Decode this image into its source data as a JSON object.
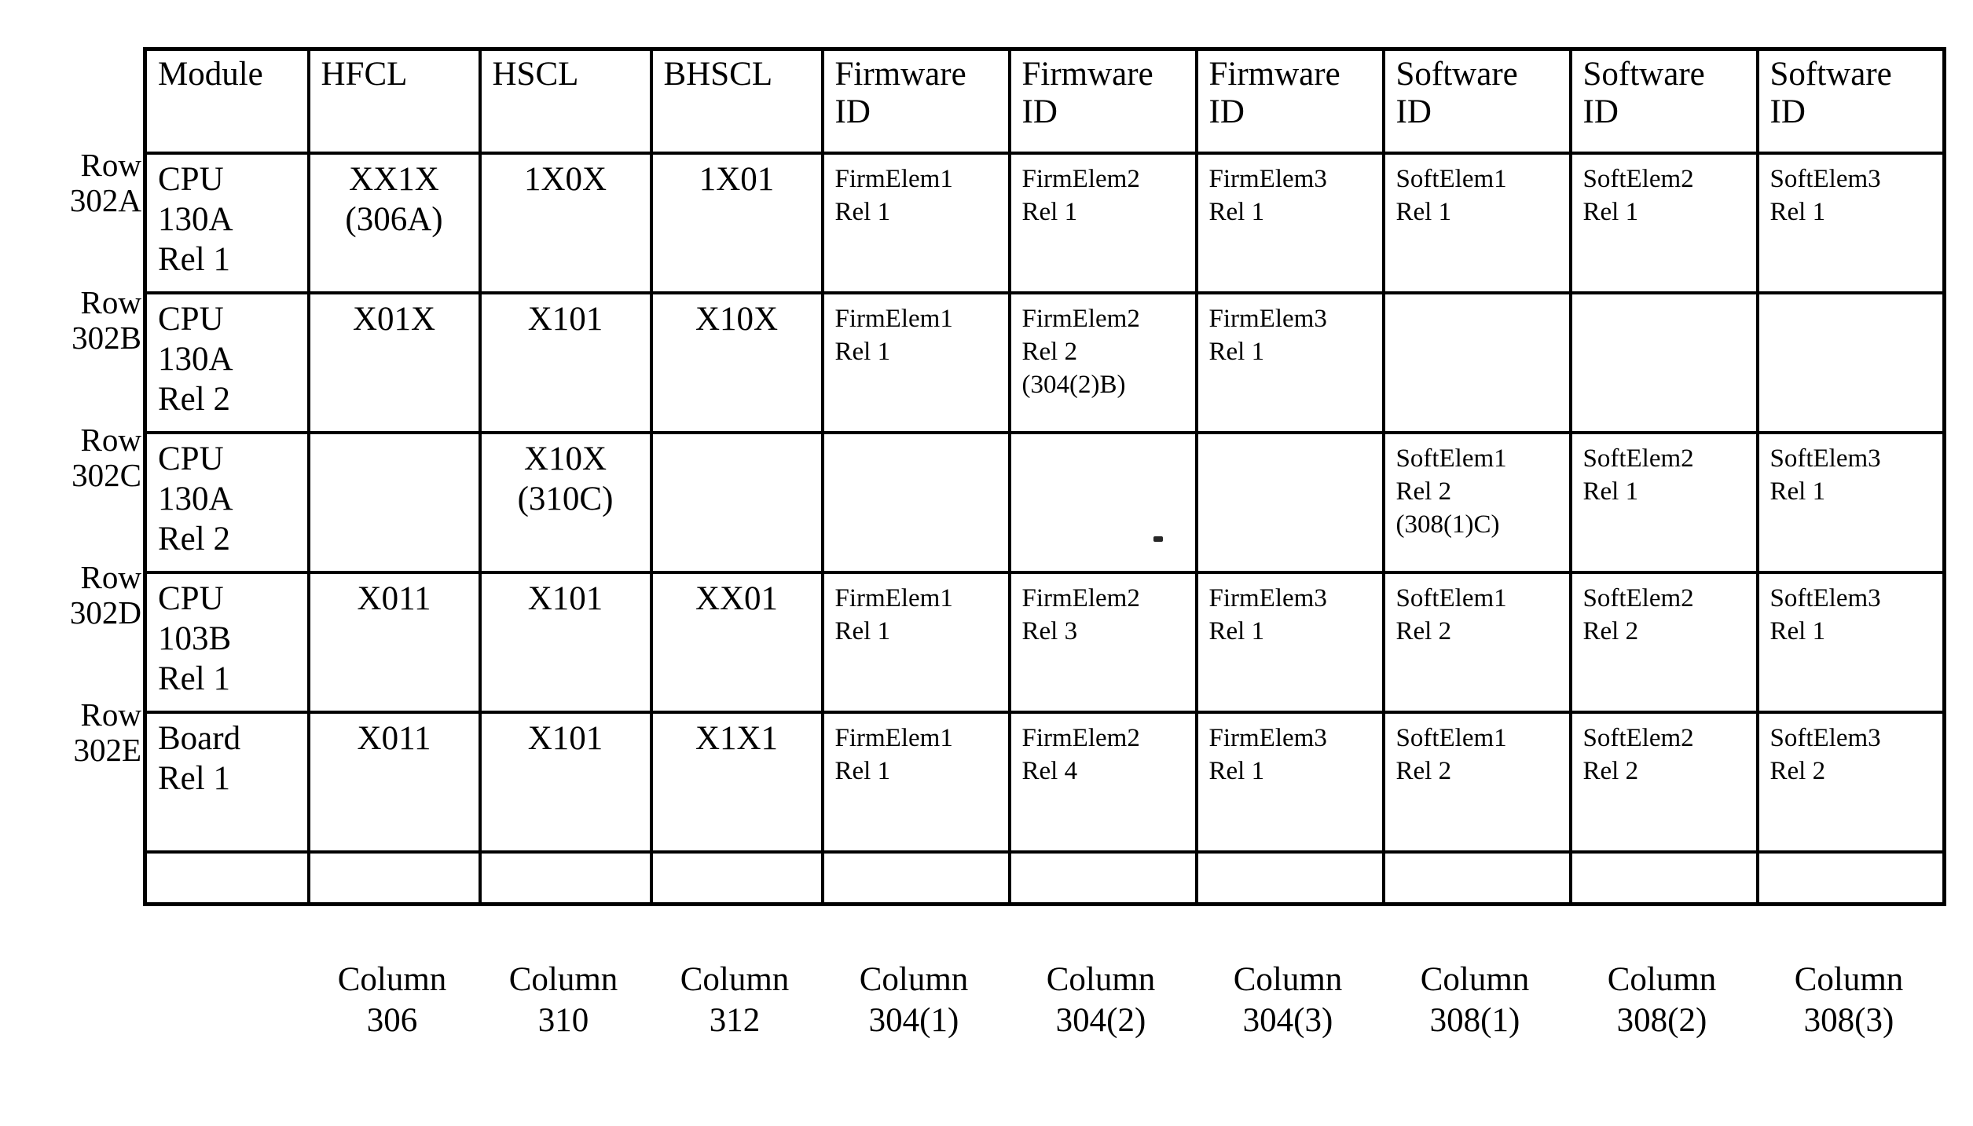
{
  "figure": {
    "row_labels": [
      {
        "line1": "Row",
        "line2": "302A"
      },
      {
        "line1": "Row",
        "line2": "302B"
      },
      {
        "line1": "Row",
        "line2": "302C"
      },
      {
        "line1": "Row",
        "line2": "302D"
      },
      {
        "line1": "Row",
        "line2": "302E"
      }
    ],
    "headers": [
      {
        "line1": "Module",
        "line2": ""
      },
      {
        "line1": "HFCL",
        "line2": ""
      },
      {
        "line1": "HSCL",
        "line2": ""
      },
      {
        "line1": "BHSCL",
        "line2": ""
      },
      {
        "line1": "Firmware",
        "line2": "ID"
      },
      {
        "line1": "Firmware",
        "line2": "ID"
      },
      {
        "line1": "Firmware",
        "line2": "ID"
      },
      {
        "line1": "Software",
        "line2": "ID"
      },
      {
        "line1": "Software",
        "line2": "ID"
      },
      {
        "line1": "Software",
        "line2": "ID"
      }
    ],
    "rows": [
      {
        "module": [
          "CPU",
          "130A",
          "Rel 1"
        ],
        "hfcl": [
          "XX1X",
          "(306A)"
        ],
        "hscl": [
          "1X0X"
        ],
        "bhscl": [
          "1X01"
        ],
        "firmware1": [
          "FirmElem1",
          "Rel 1"
        ],
        "firmware2": [
          "FirmElem2",
          "Rel 1"
        ],
        "firmware3": [
          "FirmElem3",
          "Rel 1"
        ],
        "software1": [
          "SoftElem1",
          "Rel 1"
        ],
        "software2": [
          "SoftElem2",
          "Rel 1"
        ],
        "software3": [
          "SoftElem3",
          "Rel 1"
        ]
      },
      {
        "module": [
          "CPU",
          "130A",
          "Rel 2"
        ],
        "hfcl": [
          "X01X"
        ],
        "hscl": [
          "X101"
        ],
        "bhscl": [
          "X10X"
        ],
        "firmware1": [
          "FirmElem1",
          "Rel 1"
        ],
        "firmware2": [
          "FirmElem2",
          "Rel 2",
          "(304(2)B)"
        ],
        "firmware3": [
          "FirmElem3",
          "Rel 1"
        ],
        "software1": [],
        "software2": [],
        "software3": []
      },
      {
        "module": [
          "CPU",
          "130A",
          "Rel 2"
        ],
        "hfcl": [],
        "hscl": [
          "X10X",
          "(310C)"
        ],
        "bhscl": [],
        "firmware1": [],
        "firmware2": [],
        "firmware3": [],
        "software1": [
          "SoftElem1",
          "Rel 2",
          "(308(1)C)"
        ],
        "software2": [
          "SoftElem2",
          "Rel 1"
        ],
        "software3": [
          "SoftElem3",
          "Rel 1"
        ]
      },
      {
        "module": [
          "CPU",
          "103B",
          "Rel 1"
        ],
        "hfcl": [
          "X011"
        ],
        "hscl": [
          "X101"
        ],
        "bhscl": [
          "XX01"
        ],
        "firmware1": [
          "FirmElem1",
          "Rel 1"
        ],
        "firmware2": [
          "FirmElem2",
          "Rel 3"
        ],
        "firmware3": [
          "FirmElem3",
          "Rel 1"
        ],
        "software1": [
          "SoftElem1",
          "Rel 2"
        ],
        "software2": [
          "SoftElem2",
          "Rel 2"
        ],
        "software3": [
          "SoftElem3",
          "Rel 1"
        ]
      },
      {
        "module": [
          "Board",
          "Rel 1"
        ],
        "hfcl": [
          "X011"
        ],
        "hscl": [
          "X101"
        ],
        "bhscl": [
          "X1X1"
        ],
        "firmware1": [
          "FirmElem1",
          "Rel 1"
        ],
        "firmware2": [
          "FirmElem2",
          "Rel 4"
        ],
        "firmware3": [
          "FirmElem3",
          "Rel 1"
        ],
        "software1": [
          "SoftElem1",
          "Rel 2"
        ],
        "software2": [
          "SoftElem2",
          "Rel 2"
        ],
        "software3": [
          "SoftElem3",
          "Rel 2"
        ]
      }
    ],
    "column_callouts": [
      {
        "line1": "",
        "line2": ""
      },
      {
        "line1": "Column",
        "line2": "306"
      },
      {
        "line1": "Column",
        "line2": "310"
      },
      {
        "line1": "Column",
        "line2": "312"
      },
      {
        "line1": "Column",
        "line2": "304(1)"
      },
      {
        "line1": "Column",
        "line2": "304(2)"
      },
      {
        "line1": "Column",
        "line2": "304(3)"
      },
      {
        "line1": "Column",
        "line2": "308(1)"
      },
      {
        "line1": "Column",
        "line2": "308(2)"
      },
      {
        "line1": "Column",
        "line2": "308(3)"
      }
    ]
  }
}
